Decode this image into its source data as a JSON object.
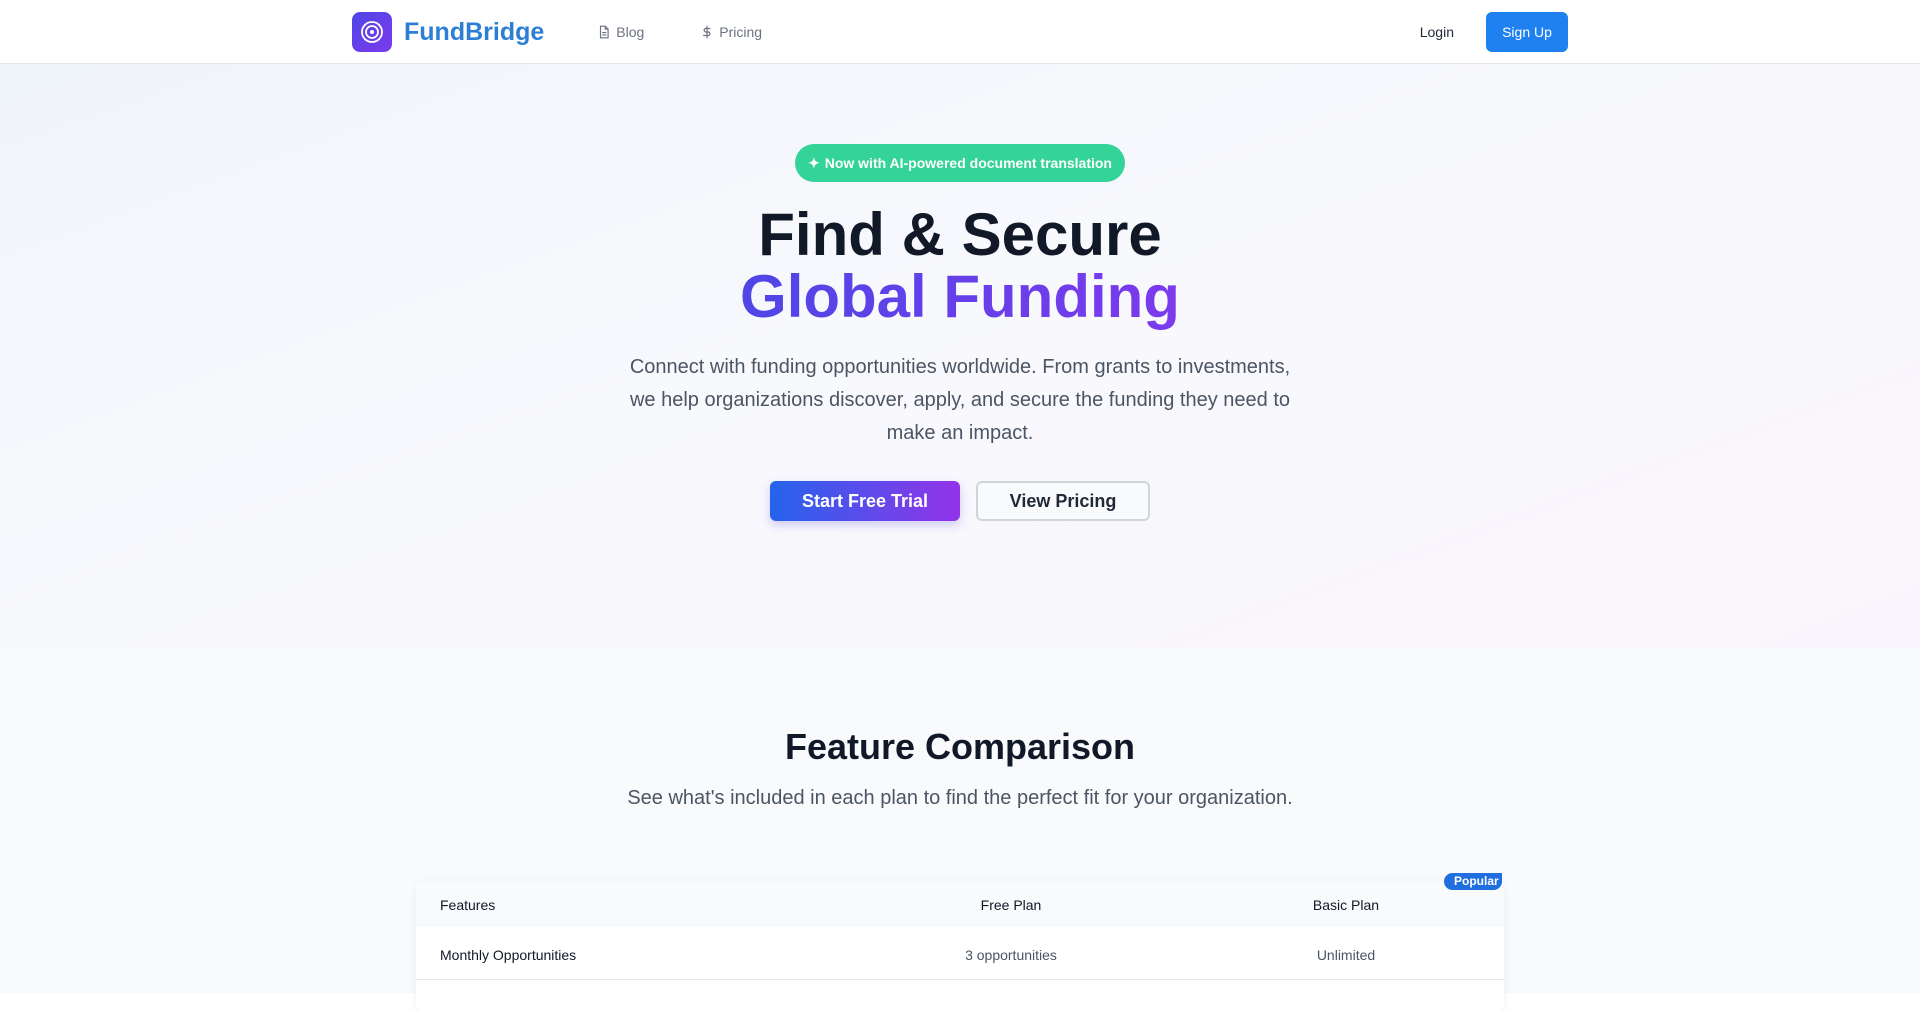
{
  "nav": {
    "brand": "FundBridge",
    "logo_icon": "target-icon",
    "links": [
      {
        "label": "Blog",
        "icon": "document-icon"
      },
      {
        "label": "Pricing",
        "icon": "dollar-icon"
      }
    ],
    "login_label": "Login",
    "signup_label": "Sign Up"
  },
  "hero": {
    "badge_icon": "sparkle-icon",
    "badge_text": "Now with AI-powered document translation",
    "title_line1": "Find & Secure",
    "title_line2": "Global Funding",
    "description": "Connect with funding opportunities worldwide. From grants to investments, we help organizations discover, apply, and secure the funding they need to make an impact.",
    "cta_primary": "Start Free Trial",
    "cta_secondary": "View Pricing"
  },
  "features": {
    "title": "Feature Comparison",
    "subtitle": "See what's included in each plan to find the perfect fit for your organization.",
    "table": {
      "columns": [
        "Features",
        "Free Plan",
        "Basic Plan"
      ],
      "popular_label": "Popular",
      "rows": [
        {
          "feature": "Monthly Opportunities",
          "free": "3 opportunities",
          "basic": "Unlimited"
        }
      ]
    }
  },
  "colors": {
    "brand": "#2d7fd6",
    "primary_button": "#1f80f0",
    "badge": "#34d399",
    "gradient_start": "#4f46e5",
    "gradient_end": "#7c3aed"
  }
}
